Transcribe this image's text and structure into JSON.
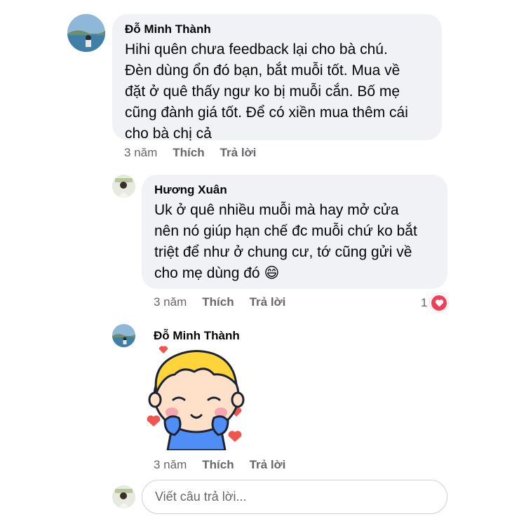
{
  "comments": [
    {
      "author": "Đỗ Minh Thành",
      "text": "Hihi quên chưa feedback lại cho bà chú.\nĐèn dùng ổn đó bạn, bắt muỗi tốt. Mua về\nđặt ở quê thấy ngư ko bị muỗi cắn. Bố mẹ\ncũng đành giá tốt. Để có xiền mua thêm cái\ncho bà chị cả",
      "time": "3 năm",
      "like_label": "Thích",
      "reply_label": "Trả lời"
    },
    {
      "author": "Hương Xuân",
      "text": "Uk ở quê nhiều muỗi mà hay mở cửa\nnên nó giúp hạn chế đc muỗi chứ ko bắt\ntriệt để như ở chung cư, tớ cũng gửi về\ncho mẹ dùng đó",
      "emoji": "😄",
      "time": "3 năm",
      "like_label": "Thích",
      "reply_label": "Trả lời",
      "reaction_count": "1",
      "reaction_icon": "heart-icon"
    },
    {
      "author": "Đỗ Minh Thành",
      "sticker": "boy-sticker-with-hearts",
      "time": "3 năm",
      "like_label": "Thích",
      "reply_label": "Trả lời"
    }
  ],
  "reply_box": {
    "placeholder": "Viết câu trả lời..."
  },
  "colors": {
    "bubble": "#f0f2f5",
    "secondary_text": "#65676b",
    "heart": "#f33e58",
    "sticker_hair": "#ffd43b",
    "sticker_shirt": "#4f8ef7"
  }
}
